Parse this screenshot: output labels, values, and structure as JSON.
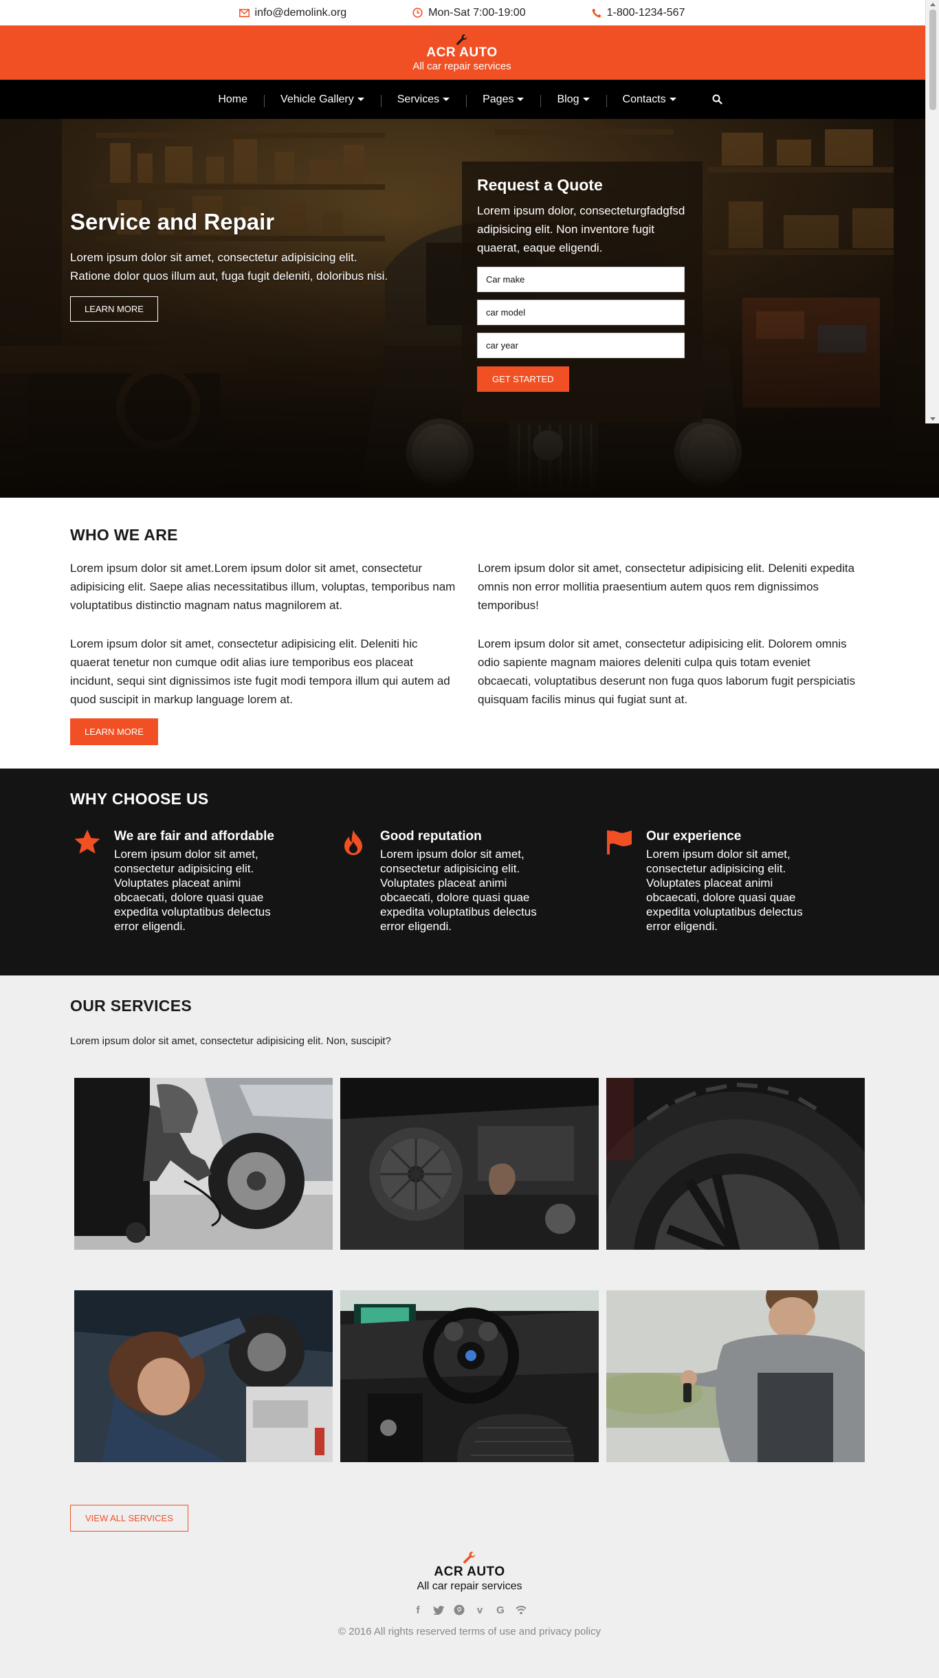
{
  "topbar": {
    "email": "info@demolink.org",
    "hours": "Mon-Sat 7:00-19:00",
    "phone": "1-800-1234-567"
  },
  "brand": {
    "name": "ACR AUTO",
    "tagline": "All car repair services"
  },
  "nav": {
    "items": [
      {
        "label": "Home"
      },
      {
        "label": "Vehicle Gallery"
      },
      {
        "label": "Services"
      },
      {
        "label": "Pages"
      },
      {
        "label": "Blog"
      },
      {
        "label": "Contacts"
      }
    ]
  },
  "hero": {
    "title": "Service and Repair",
    "text": "Lorem ipsum dolor sit amet, consectetur adipisicing elit. Ratione dolor quos illum aut, fuga fugit deleniti, doloribus nisi.",
    "button": "Learn More"
  },
  "quote": {
    "title": "Request a Quote",
    "text": "Lorem ipsum dolor, consecteturgfadgfsd adipisicing elit. Non inventore fugit quaerat, eaque eligendi.",
    "fields": [
      "Car make",
      "car model",
      "car year"
    ],
    "button": "Get Started"
  },
  "who": {
    "title": "Who We Are",
    "left": [
      "Lorem ipsum dolor sit amet.Lorem ipsum dolor sit amet, consectetur adipisicing elit. Saepe alias necessitatibus illum, voluptas, temporibus nam voluptatibus distinctio magnam natus magnilorem at.",
      "Lorem ipsum dolor sit amet, consectetur adipisicing elit. Deleniti hic quaerat tenetur non cumque odit alias iure temporibus eos placeat incidunt, sequi sint dignissimos iste fugit modi tempora illum qui autem ad quod suscipit in markup language lorem at."
    ],
    "right": [
      "Lorem ipsum dolor sit amet, consectetur adipisicing elit. Deleniti expedita omnis non error mollitia praesentium autem quos rem dignissimos temporibus!",
      "Lorem ipsum dolor sit amet, consectetur adipisicing elit. Dolorem omnis odio sapiente magnam maiores deleniti culpa quis totam eveniet obcaecati, voluptatibus deserunt non fuga quos laborum fugit perspiciatis quisquam facilis minus qui fugiat sunt at."
    ],
    "button": "Learn More"
  },
  "why": {
    "title": "Why Choose Us",
    "features": [
      {
        "icon": "star-icon",
        "title": "We are fair and affordable",
        "text": "Lorem ipsum dolor sit amet, consectetur adipisicing elit. Voluptates placeat animi obcaecati, dolore quasi quae expedita voluptatibus delectus error eligendi."
      },
      {
        "icon": "fire-icon",
        "title": "Good reputation",
        "text": "Lorem ipsum dolor sit amet, consectetur adipisicing elit. Voluptates placeat animi obcaecati, dolore quasi quae expedita voluptatibus delectus error eligendi."
      },
      {
        "icon": "flag-icon",
        "title": "Our experience",
        "text": "Lorem ipsum dolor sit amet, consectetur adipisicing elit. Voluptates placeat animi obcaecati, dolore quasi quae expedita voluptatibus delectus error eligendi."
      }
    ]
  },
  "services": {
    "title": "Our Services",
    "intro": "Lorem ipsum dolor sit amet, consectetur adipisicing elit. Non, suscipit?",
    "button": "View All Services"
  },
  "footer": {
    "name": "ACR AUTO",
    "tagline": "All car repair services",
    "socials": [
      "facebook-icon",
      "twitter-icon",
      "pinterest-icon",
      "vimeo-icon",
      "google-icon",
      "rss-icon"
    ],
    "copyright": "© 2016 All rights reserved terms of use and privacy policy"
  },
  "colors": {
    "accent": "#f05023",
    "dark": "#141414",
    "light_bg": "#efefef"
  }
}
